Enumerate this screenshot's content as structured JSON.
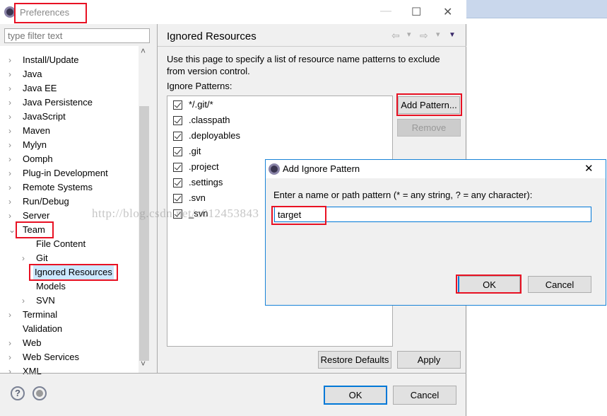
{
  "window": {
    "title": "Preferences",
    "minimize": "—",
    "maximize": "☐",
    "close": "✕"
  },
  "filter": {
    "placeholder": "type filter text"
  },
  "tree": [
    {
      "label": "Install/Update",
      "level": 0,
      "arrow": "›"
    },
    {
      "label": "Java",
      "level": 0,
      "arrow": "›"
    },
    {
      "label": "Java EE",
      "level": 0,
      "arrow": "›"
    },
    {
      "label": "Java Persistence",
      "level": 0,
      "arrow": "›"
    },
    {
      "label": "JavaScript",
      "level": 0,
      "arrow": "›"
    },
    {
      "label": "Maven",
      "level": 0,
      "arrow": "›"
    },
    {
      "label": "Mylyn",
      "level": 0,
      "arrow": "›"
    },
    {
      "label": "Oomph",
      "level": 0,
      "arrow": "›"
    },
    {
      "label": "Plug-in Development",
      "level": 0,
      "arrow": "›"
    },
    {
      "label": "Remote Systems",
      "level": 0,
      "arrow": "›"
    },
    {
      "label": "Run/Debug",
      "level": 0,
      "arrow": "›"
    },
    {
      "label": "Server",
      "level": 0,
      "arrow": "›"
    },
    {
      "label": "Team",
      "level": 0,
      "arrow": "⌄",
      "expanded": true,
      "highlighted": true
    },
    {
      "label": "File Content",
      "level": 1,
      "arrow": ""
    },
    {
      "label": "Git",
      "level": 1,
      "arrow": "›"
    },
    {
      "label": "Ignored Resources",
      "level": 1,
      "arrow": "",
      "selected": true,
      "highlighted": true
    },
    {
      "label": "Models",
      "level": 1,
      "arrow": ""
    },
    {
      "label": "SVN",
      "level": 1,
      "arrow": "›"
    },
    {
      "label": "Terminal",
      "level": 0,
      "arrow": "›"
    },
    {
      "label": "Validation",
      "level": 0,
      "arrow": ""
    },
    {
      "label": "Web",
      "level": 0,
      "arrow": "›"
    },
    {
      "label": "Web Services",
      "level": 0,
      "arrow": "›"
    },
    {
      "label": "XML",
      "level": 0,
      "arrow": "›"
    }
  ],
  "scroll": {
    "up": "˄",
    "down": "˅"
  },
  "page": {
    "title": "Ignored Resources",
    "nav": {
      "back": "⇦",
      "forward": "⇨",
      "dropdown": "▾",
      "menu": "▼"
    },
    "description": "Use this page to specify a list of resource name patterns to exclude from version control.",
    "patterns_label": "Ignore Patterns:",
    "patterns": [
      {
        "text": "*/.git/*",
        "checked": true
      },
      {
        "text": ".classpath",
        "checked": true
      },
      {
        "text": ".deployables",
        "checked": true
      },
      {
        "text": ".git",
        "checked": true
      },
      {
        "text": ".project",
        "checked": true
      },
      {
        "text": ".settings",
        "checked": true
      },
      {
        "text": ".svn",
        "checked": true
      },
      {
        "text": "_svn",
        "checked": true
      }
    ],
    "add_pattern": "Add Pattern...",
    "remove": "Remove",
    "restore_defaults": "Restore Defaults",
    "apply": "Apply"
  },
  "footer": {
    "help": "?",
    "ok": "OK",
    "cancel": "Cancel"
  },
  "dialog": {
    "title": "Add Ignore Pattern",
    "close": "✕",
    "prompt": "Enter a name or path pattern (* = any string, ? = any character):",
    "value": "target",
    "ok": "OK",
    "cancel": "Cancel"
  },
  "watermark": "http://blog.csdn.net/u012453843",
  "colors": {
    "highlight": "#e81123",
    "selection": "#cce8ff",
    "focus": "#0078d7"
  }
}
